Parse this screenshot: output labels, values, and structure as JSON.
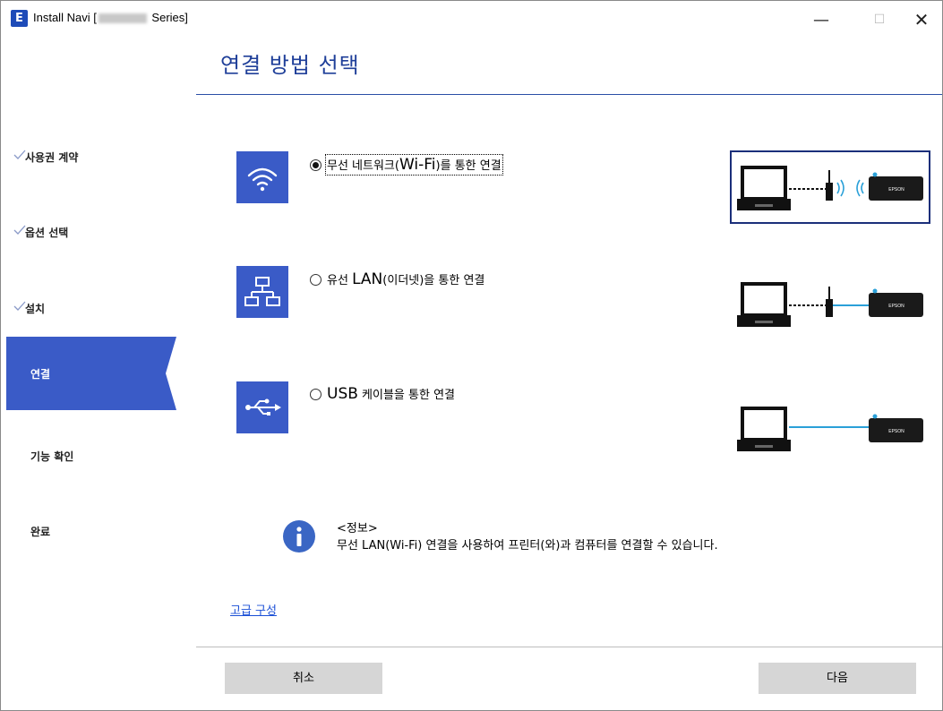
{
  "window": {
    "title_prefix": "Install Navi [",
    "title_suffix": " Series]",
    "app_icon_letter": "E",
    "minimize_glyph": "—",
    "maximize_glyph": "☐",
    "close_glyph": "✕"
  },
  "sidebar": {
    "items": [
      {
        "label": "사용권 계약",
        "state": "done"
      },
      {
        "label": "옵션 선택",
        "state": "done"
      },
      {
        "label": "설치",
        "state": "done"
      },
      {
        "label": "연결",
        "state": "active"
      },
      {
        "label": "기능 확인",
        "state": "todo"
      },
      {
        "label": "완료",
        "state": "todo"
      }
    ],
    "active_color": "#3a5bc7"
  },
  "header": {
    "title": "연결 방법 선택",
    "color": "#1f3f99"
  },
  "options": [
    {
      "icon": "wifi-icon",
      "label_pre": "무선 네트워크(",
      "label_big": "Wi-Fi",
      "label_post": ")를 통한 연결",
      "selected": true
    },
    {
      "icon": "network-icon",
      "label_pre": "유선 ",
      "label_big": "LAN",
      "label_post": "(이더넷)을 통한 연결",
      "selected": false
    },
    {
      "icon": "usb-icon",
      "label_pre": "",
      "label_big": "USB",
      "label_post": " 케이블을 통한 연결",
      "selected": false
    }
  ],
  "diagrams": {
    "printer_brand": "EPSON"
  },
  "info": {
    "title": "<정보>",
    "text": "무선 LAN(Wi-Fi) 연결을 사용하여 프린터(와)과 컴퓨터를 연결할 수 있습니다."
  },
  "links": {
    "advanced": "고급 구성"
  },
  "buttons": {
    "cancel": "취소",
    "next": "다음"
  }
}
